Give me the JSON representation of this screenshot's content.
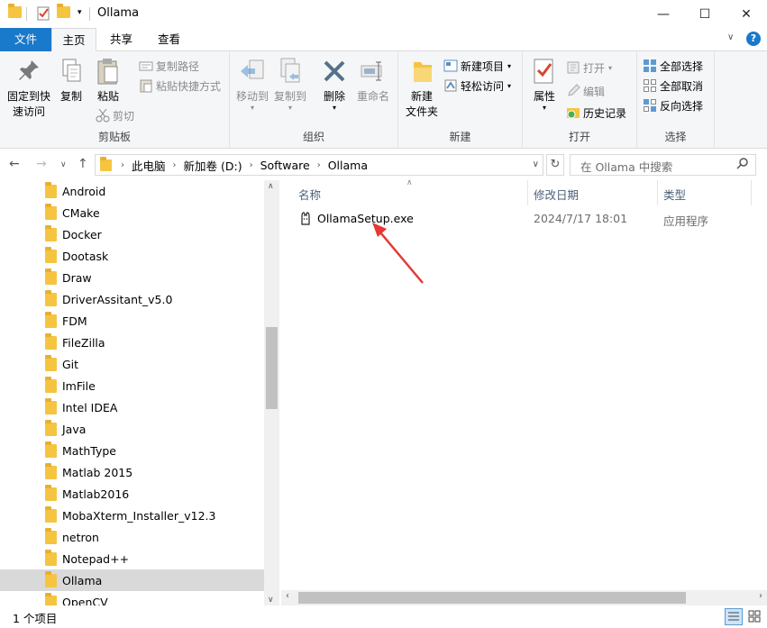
{
  "window": {
    "title": "Ollama",
    "minimize": "—",
    "maximize": "☐",
    "close": "✕",
    "help": "?"
  },
  "tabs": [
    "文件",
    "主页",
    "共享",
    "查看"
  ],
  "ribbon": {
    "clipboard": {
      "label": "剪贴板",
      "pin": "固定到快\n速访问",
      "pin_line1": "固定到快",
      "pin_line2": "速访问",
      "copy": "复制",
      "paste": "粘贴",
      "copy_path": "复制路径",
      "paste_shortcut": "粘贴快捷方式",
      "cut": "剪切"
    },
    "organize": {
      "label": "组织",
      "move_to": "移动到",
      "copy_to": "复制到",
      "delete": "删除",
      "rename": "重命名"
    },
    "new": {
      "label": "新建",
      "new_folder_line1": "新建",
      "new_folder_line2": "文件夹",
      "new_item": "新建项目",
      "easy_access": "轻松访问"
    },
    "open": {
      "label": "打开",
      "properties": "属性",
      "open": "打开",
      "edit": "编辑",
      "history": "历史记录"
    },
    "select": {
      "label": "选择",
      "select_all": "全部选择",
      "select_none": "全部取消",
      "invert": "反向选择"
    }
  },
  "address": {
    "crumbs": [
      "此电脑",
      "新加卷 (D:)",
      "Software",
      "Ollama"
    ],
    "search_placeholder": "在 Ollama 中搜索"
  },
  "nav_items": [
    "Android",
    "CMake",
    "Docker",
    "Dootask",
    "Draw",
    "DriverAssitant_v5.0",
    "FDM",
    "FileZilla",
    "Git",
    "ImFile",
    "Intel IDEA",
    "Java",
    "MathType",
    "Matlab 2015",
    "Matlab2016",
    "MobaXterm_Installer_v12.3",
    "netron",
    "Notepad++",
    "Ollama",
    "OpenCV"
  ],
  "selected_nav": "Ollama",
  "columns": {
    "name": "名称",
    "date": "修改日期",
    "type": "类型"
  },
  "files": [
    {
      "name": "OllamaSetup.exe",
      "date": "2024/7/17 18:01",
      "type": "应用程序"
    }
  ],
  "status": {
    "count": "1 个项目"
  },
  "colors": {
    "file_tab": "#1979ca",
    "arrow": "#e53935",
    "folder": "#f5c542"
  }
}
